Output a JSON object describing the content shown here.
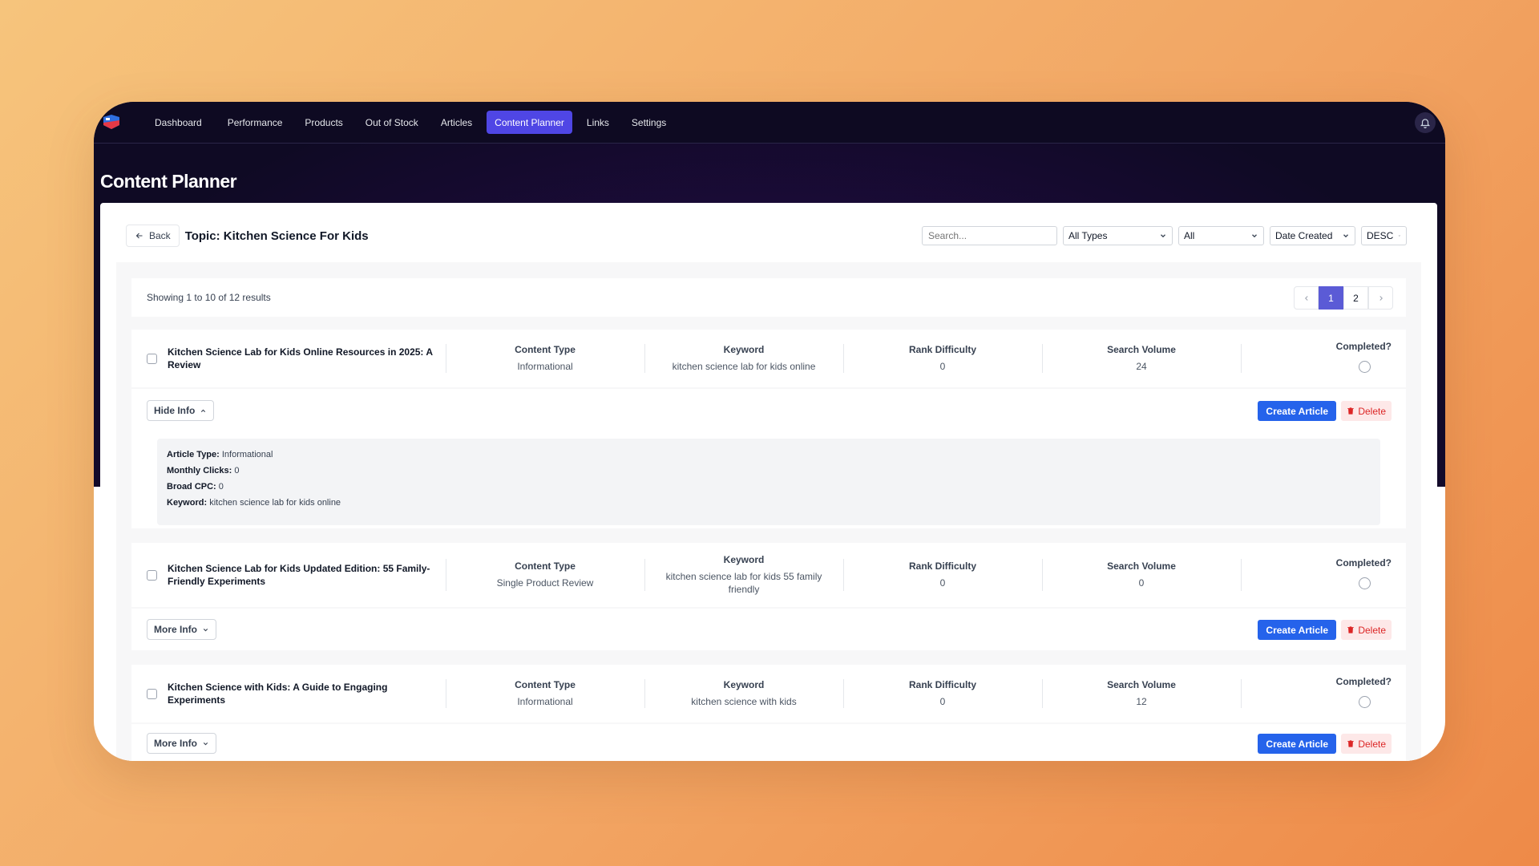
{
  "nav": {
    "items": [
      {
        "label": "Dashboard"
      },
      {
        "label": "Performance"
      },
      {
        "label": "Products"
      },
      {
        "label": "Out of Stock"
      },
      {
        "label": "Articles"
      },
      {
        "label": "Content Planner"
      },
      {
        "label": "Links"
      },
      {
        "label": "Settings"
      }
    ],
    "active_index": 5
  },
  "page": {
    "title": "Content Planner"
  },
  "topic": {
    "back_label": "Back",
    "title": "Topic: Kitchen Science For Kids"
  },
  "filters": {
    "search_placeholder": "Search...",
    "type_selected": "All Types",
    "status_selected": "All",
    "sort_field_selected": "Date Created",
    "sort_order_selected": "DESC"
  },
  "results": {
    "summary": "Showing 1 to 10 of 12 results",
    "pages": [
      "1",
      "2"
    ],
    "current_page": "1"
  },
  "columns": {
    "content_type": "Content Type",
    "keyword": "Keyword",
    "rank_difficulty": "Rank Difficulty",
    "search_volume": "Search Volume",
    "completed": "Completed?"
  },
  "actions": {
    "create_label": "Create Article",
    "delete_label": "Delete",
    "more_info_label": "More Info",
    "hide_info_label": "Hide Info"
  },
  "items": [
    {
      "title": "Kitchen Science Lab for Kids Online Resources in 2025: A Review",
      "content_type": "Informational",
      "keyword": "kitchen science lab for kids online",
      "rank_difficulty": "0",
      "search_volume": "24",
      "expanded": true,
      "details": {
        "article_type_label": "Article Type:",
        "article_type": "Informational",
        "monthly_clicks_label": "Monthly Clicks:",
        "monthly_clicks": "0",
        "broad_cpc_label": "Broad CPC:",
        "broad_cpc": "0",
        "keyword_label": "Keyword:",
        "keyword": "kitchen science lab for kids online"
      }
    },
    {
      "title": "Kitchen Science Lab for Kids Updated Edition: 55 Family-Friendly Experiments",
      "content_type": "Single Product Review",
      "keyword": "kitchen science lab for kids 55 family friendly",
      "rank_difficulty": "0",
      "search_volume": "0",
      "expanded": false
    },
    {
      "title": "Kitchen Science with Kids: A Guide to Engaging Experiments",
      "content_type": "Informational",
      "keyword": "kitchen science with kids",
      "rank_difficulty": "0",
      "search_volume": "12",
      "expanded": false
    }
  ]
}
